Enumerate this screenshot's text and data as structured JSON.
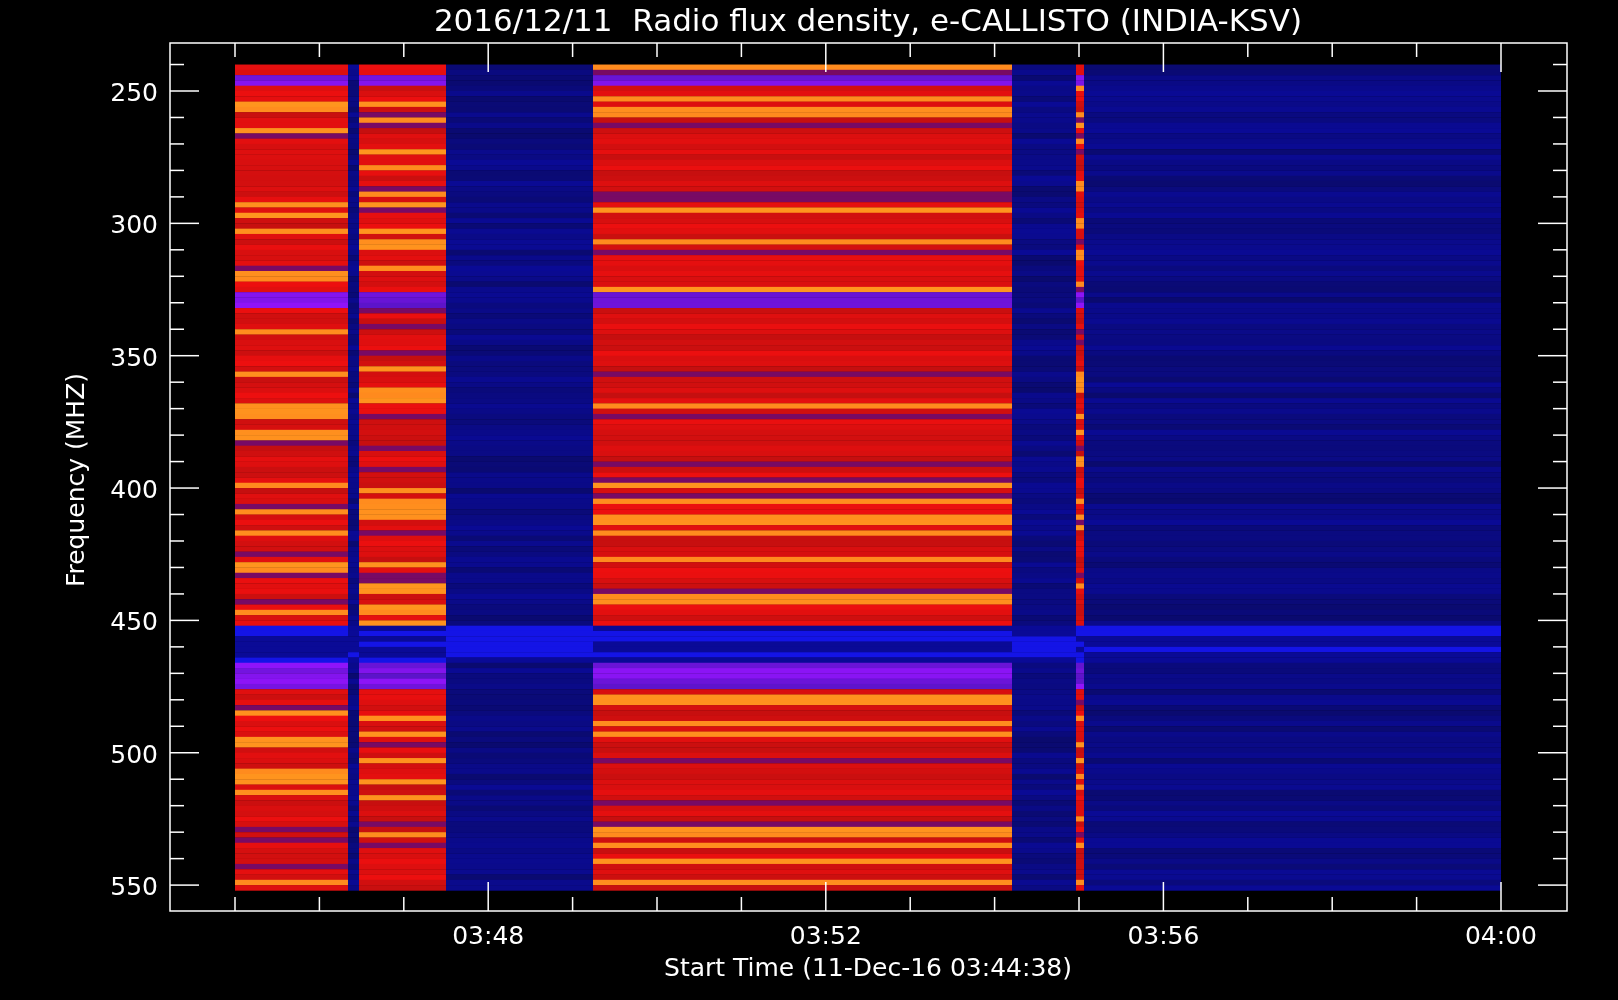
{
  "title": "2016/12/11  Radio flux density, e-CALLISTO (INDIA-KSV)",
  "y_axis": {
    "label": "Frequency (MHZ)",
    "ticks": [
      "250",
      "300",
      "350",
      "400",
      "450",
      "500",
      "550"
    ]
  },
  "x_axis": {
    "label": "Start Time (11-Dec-16 03:44:38)",
    "ticks": [
      "03:48",
      "03:52",
      "03:56",
      "04:00"
    ]
  }
}
